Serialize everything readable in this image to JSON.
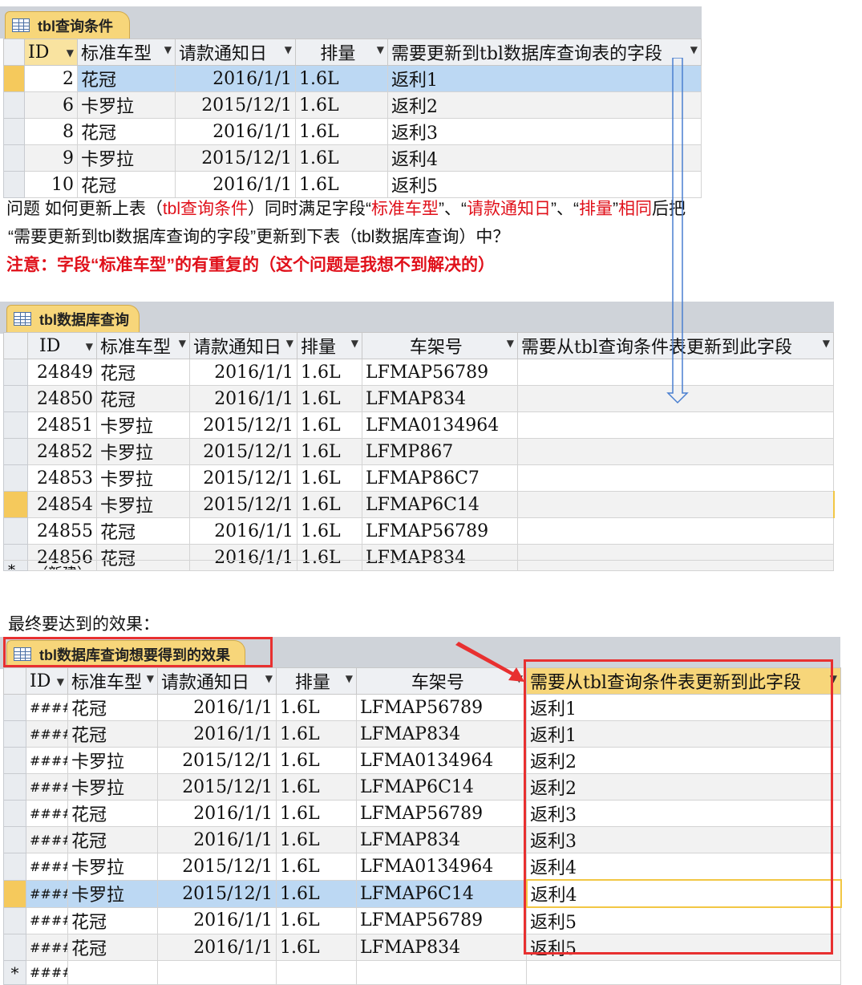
{
  "table1": {
    "tab_label": "tbl查询条件",
    "columns": [
      "ID",
      "标准车型",
      "请款通知日",
      "排量",
      "需要更新到tbl数据库查询表的字段"
    ],
    "rows": [
      {
        "id": "2",
        "model": "花冠",
        "date": "2016/1/1",
        "disp": "1.6L",
        "field": "返利1"
      },
      {
        "id": "6",
        "model": "卡罗拉",
        "date": "2015/12/1",
        "disp": "1.6L",
        "field": "返利2"
      },
      {
        "id": "8",
        "model": "花冠",
        "date": "2016/1/1",
        "disp": "1.6L",
        "field": "返利3"
      },
      {
        "id": "9",
        "model": "卡罗拉",
        "date": "2015/12/1",
        "disp": "1.6L",
        "field": "返利4"
      },
      {
        "id": "10",
        "model": "花冠",
        "date": "2016/1/1",
        "disp": "1.6L",
        "field": "返利5"
      }
    ]
  },
  "question": {
    "line1_a": "问题 如何更新上表（",
    "line1_b": "tbl查询条件",
    "line1_c": "）同时满足字段“",
    "line1_d": "标准车型",
    "line1_e": "”、“",
    "line1_f": "请款通知日",
    "line1_g": "”、“",
    "line1_h": "排量",
    "line1_i": "”",
    "line1_j": "相同",
    "line1_k": "后把",
    "line2": "“需要更新到tbl数据库查询的字段”更新到下表（tbl数据库查询）中？",
    "line3": "注意：字段“标准车型”的有重复的（这个问题是我想不到解决的）"
  },
  "table2": {
    "tab_label": "tbl数据库查询",
    "columns": [
      "ID",
      "标准车型",
      "请款通知日",
      "排量",
      "车架号",
      "需要从tbl查询条件表更新到此字段"
    ],
    "rows": [
      {
        "id": "24849",
        "model": "花冠",
        "date": "2016/1/1",
        "disp": "1.6L",
        "vin": "LFMAP56789",
        "field": ""
      },
      {
        "id": "24850",
        "model": "花冠",
        "date": "2016/1/1",
        "disp": "1.6L",
        "vin": "LFMAP834",
        "field": ""
      },
      {
        "id": "24851",
        "model": "卡罗拉",
        "date": "2015/12/1",
        "disp": "1.6L",
        "vin": "LFMA0134964",
        "field": ""
      },
      {
        "id": "24852",
        "model": "卡罗拉",
        "date": "2015/12/1",
        "disp": "1.6L",
        "vin": "LFMP867",
        "field": ""
      },
      {
        "id": "24853",
        "model": "卡罗拉",
        "date": "2015/12/1",
        "disp": "1.6L",
        "vin": "LFMAP86C7",
        "field": ""
      },
      {
        "id": "24854",
        "model": "卡罗拉",
        "date": "2015/12/1",
        "disp": "1.6L",
        "vin": "LFMAP6C14",
        "field": ""
      },
      {
        "id": "24855",
        "model": "花冠",
        "date": "2016/1/1",
        "disp": "1.6L",
        "vin": "LFMAP56789",
        "field": ""
      },
      {
        "id": "24856",
        "model": "花冠",
        "date": "2016/1/1",
        "disp": "1.6L",
        "vin": "LFMAP834",
        "field": ""
      }
    ],
    "new_row_label": "（新建）"
  },
  "result_heading": "最终要达到的效果：",
  "table3": {
    "tab_label": "tbl数据库查询想要得到的效果",
    "columns": [
      "ID",
      "标准车型",
      "请款通知日",
      "排量",
      "车架号",
      "需要从tbl查询条件表更新到此字段"
    ],
    "rows": [
      {
        "id": "####",
        "model": "花冠",
        "date": "2016/1/1",
        "disp": "1.6L",
        "vin": "LFMAP56789",
        "field": "返利1"
      },
      {
        "id": "####",
        "model": "花冠",
        "date": "2016/1/1",
        "disp": "1.6L",
        "vin": "LFMAP834",
        "field": "返利1"
      },
      {
        "id": "####",
        "model": "卡罗拉",
        "date": "2015/12/1",
        "disp": "1.6L",
        "vin": "LFMA0134964",
        "field": "返利2"
      },
      {
        "id": "####",
        "model": "卡罗拉",
        "date": "2015/12/1",
        "disp": "1.6L",
        "vin": "LFMAP6C14",
        "field": "返利2"
      },
      {
        "id": "####",
        "model": "花冠",
        "date": "2016/1/1",
        "disp": "1.6L",
        "vin": "LFMAP56789",
        "field": "返利3"
      },
      {
        "id": "####",
        "model": "花冠",
        "date": "2016/1/1",
        "disp": "1.6L",
        "vin": "LFMAP834",
        "field": "返利3"
      },
      {
        "id": "####",
        "model": "卡罗拉",
        "date": "2015/12/1",
        "disp": "1.6L",
        "vin": "LFMA0134964",
        "field": "返利4"
      },
      {
        "id": "####",
        "model": "卡罗拉",
        "date": "2015/12/1",
        "disp": "1.6L",
        "vin": "LFMAP6C14",
        "field": "返利4"
      },
      {
        "id": "####",
        "model": "花冠",
        "date": "2016/1/1",
        "disp": "1.6L",
        "vin": "LFMAP56789",
        "field": "返利5"
      },
      {
        "id": "####",
        "model": "花冠",
        "date": "2016/1/1",
        "disp": "1.6L",
        "vin": "LFMAP834",
        "field": "返利5"
      }
    ],
    "new_row_id": "####"
  },
  "colors": {
    "tab": "#f7d67a",
    "highlight_row": "#bcd8f3",
    "annotation_red": "#e0101a",
    "arrow_blue": "#4a7fd0",
    "new_row_marker": "*"
  }
}
